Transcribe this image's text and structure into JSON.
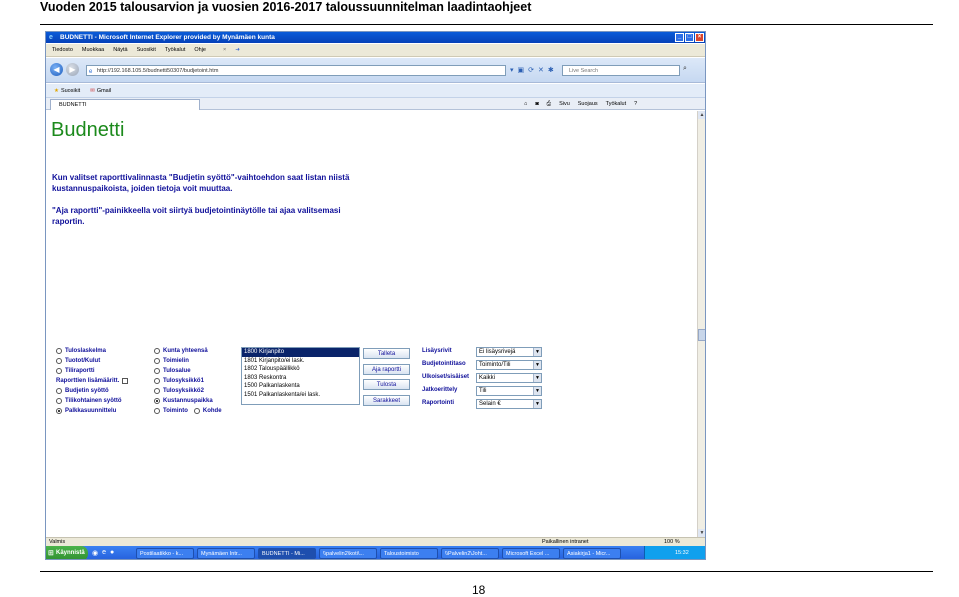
{
  "doc": {
    "title": "Vuoden 2015 talousarvion ja vuosien 2016-2017 taloussuunnitelman laadintaohjeet",
    "page_number": "18"
  },
  "window": {
    "title": "BUDNETTI - Microsoft Internet Explorer provided by Mynämäen kunta",
    "buttons": [
      "_",
      "□",
      "×"
    ]
  },
  "menu": {
    "items": [
      "Tiedosto",
      "Muokkaa",
      "Näytä",
      "Suosikit",
      "Työkalut",
      "Ohje"
    ],
    "close": "×"
  },
  "address": {
    "url": "http://192.168.105.5/budnetti50307/budjetoint.htm",
    "search_placeholder": "Live Search"
  },
  "favorites": {
    "items": [
      "Suosikit",
      "Gmail"
    ]
  },
  "tab": {
    "label": "BUDNETTI",
    "commands": [
      "Sivu",
      "Suojaus",
      "Työkalut"
    ]
  },
  "page": {
    "heading": "Budnetti",
    "help1": "Kun valitset raporttivalinnasta \"Budjetin syöttö\"-vaihtoehdon saat listan niistä kustannuspaikoista, joiden tietoja voit muuttaa.",
    "help2": "\"Aja raportti\"-painikkeella voit siirtyä budjetointinäytölle tai ajaa valitsemasi raportin."
  },
  "report_options_col1": [
    {
      "label": "Tuloslaskelma",
      "checked": false
    },
    {
      "label": "Tuotot/Kulut",
      "checked": false
    },
    {
      "label": "Tiliraportti",
      "checked": false
    },
    {
      "label": "Raporttien lisämääritt.",
      "checked": false,
      "checkbox": true
    },
    {
      "label": "Budjetin syöttö",
      "checked": false
    },
    {
      "label": "Tilikohtainen syöttö",
      "checked": false
    },
    {
      "label": "Palkkasuunnittelu",
      "checked": true
    }
  ],
  "report_options_col2": [
    {
      "label": "Kunta yhteensä",
      "checked": false
    },
    {
      "label": "Toimielin",
      "checked": false
    },
    {
      "label": "Tulosalue",
      "checked": false
    },
    {
      "label": "Tulosyksikkö1",
      "checked": false
    },
    {
      "label": "Tulosyksikkö2",
      "checked": false
    },
    {
      "label": "Kustannuspaikka",
      "checked": true
    },
    {
      "label": "Toiminto",
      "checked": false,
      "extra": "Kohde"
    }
  ],
  "cost_centers": [
    {
      "label": "1800 Kirjanpito",
      "selected": true
    },
    {
      "label": "1801 Kirjanpito/ei lask.",
      "selected": false
    },
    {
      "label": "1802 Talouspäällikkö",
      "selected": false
    },
    {
      "label": "1803 Reskontra",
      "selected": false
    },
    {
      "label": "1500 Palkanlaskenta",
      "selected": false
    },
    {
      "label": "1501 Palkanlaskenta/ei lask.",
      "selected": false
    }
  ],
  "actions": [
    "Talleta",
    "Aja raportti",
    "Tulosta",
    "Sarakkeet"
  ],
  "fields": [
    {
      "label": "Lisäysrivit",
      "value": "Ei lisäysrivejä"
    },
    {
      "label": "Budjetointitaso",
      "value": "Toiminto/Tili"
    },
    {
      "label": "Ulkoiset/sisäiset",
      "value": "Kaikki"
    },
    {
      "label": "Jatkoerittely",
      "value": "Tili"
    },
    {
      "label": "Raportointi",
      "value": "Selain €"
    }
  ],
  "status": {
    "left": "Valmis",
    "zone": "Paikallinen intranet",
    "zoom": "100 %"
  },
  "taskbar": {
    "start": "Käynnistä",
    "items": [
      {
        "label": "Postilaatikko - k...",
        "active": false
      },
      {
        "label": "Mynämäen Intr...",
        "active": false
      },
      {
        "label": "BUDNETTI - Mi...",
        "active": true
      },
      {
        "label": "\\\\palvelin2\\koti\\...",
        "active": false
      },
      {
        "label": "Taloustoimisto",
        "active": false
      },
      {
        "label": "\\\\Palvelin2\\Joht...",
        "active": false
      },
      {
        "label": "Microsoft Excel ...",
        "active": false
      },
      {
        "label": "Asiakirja1 - Micr...",
        "active": false
      }
    ],
    "clock": "15:32"
  },
  "colors": {
    "heading": "#1c8a1c",
    "label": "#10109a",
    "titlebar": "#0a5bd8",
    "taskbar": "#245edb"
  }
}
